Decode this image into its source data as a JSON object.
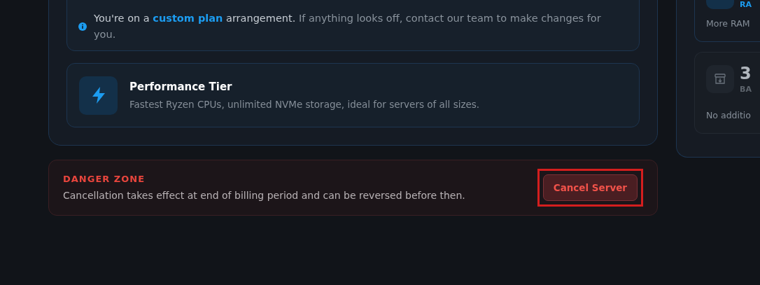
{
  "plan_notice": {
    "parts": [
      {
        "text": "You're on a ",
        "kind": "plain"
      },
      {
        "text": "custom plan",
        "kind": "link"
      },
      {
        "text": " arrangement.",
        "kind": "plain"
      },
      {
        "text": " If anything looks off, contact our team to make changes for you.",
        "kind": "muted"
      }
    ]
  },
  "tier": {
    "title": "Performance Tier",
    "description": "Fastest Ryzen CPUs, unlimited NVMe storage, ideal for servers of all sizes."
  },
  "danger_zone": {
    "title": "DANGER ZONE",
    "description": "Cancellation takes effect at end of billing period and can be reversed before then.",
    "button": {
      "label": "Cancel Server",
      "highlighted": true
    }
  },
  "side_cards": [
    {
      "kind": "active",
      "label": "RA",
      "note": "More RAM"
    },
    {
      "kind": "inactive",
      "value": "3",
      "label": "BA",
      "note": "No additio"
    }
  ]
}
